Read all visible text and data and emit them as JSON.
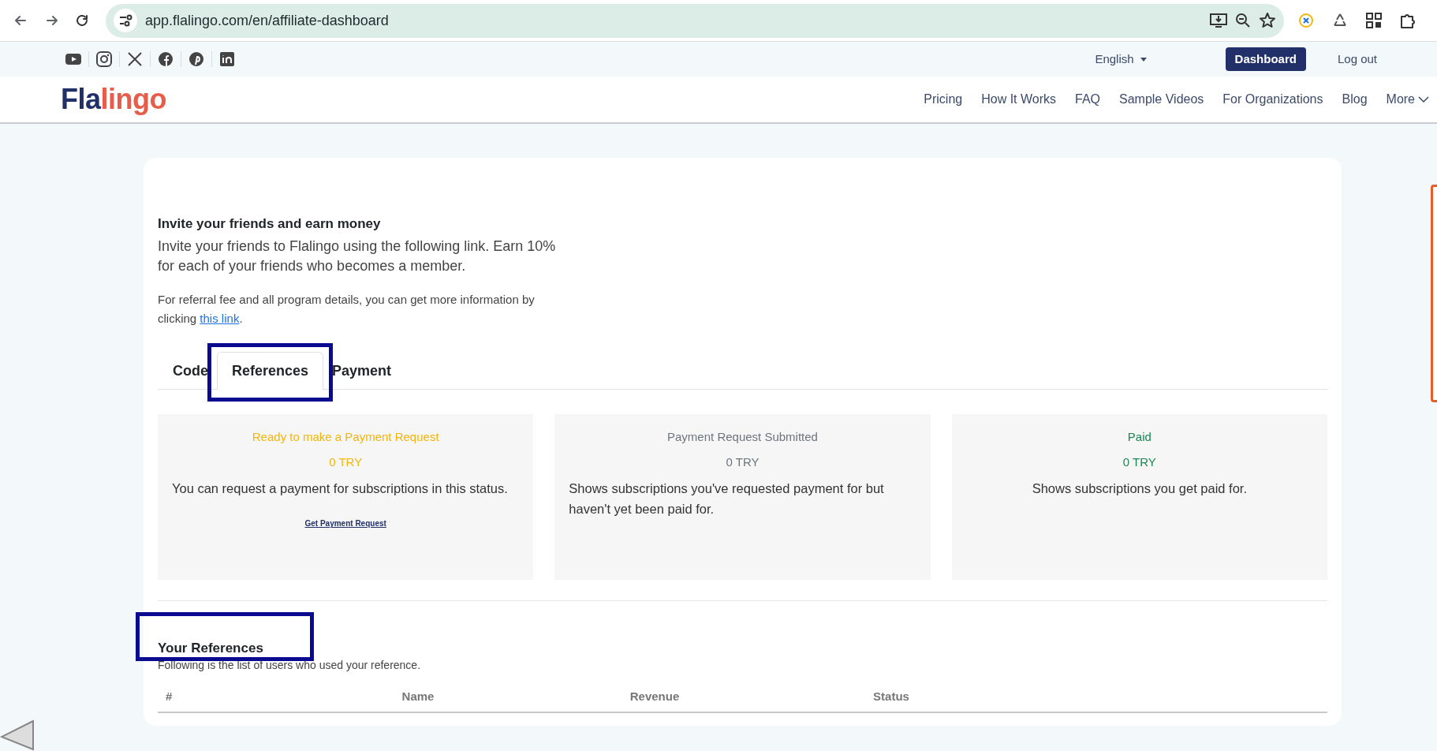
{
  "browser": {
    "url": "app.flalingo.com/en/affiliate-dashboard"
  },
  "topbar": {
    "language": "English",
    "dashboard_button": "Dashboard",
    "logout": "Log out"
  },
  "logo": {
    "part_1": "Fla",
    "part_2": "lingo"
  },
  "nav": [
    "Pricing",
    "How It Works",
    "FAQ",
    "Sample Videos",
    "For Organizations",
    "Blog"
  ],
  "nav_more": "More",
  "intro": {
    "title": "Invite your friends and earn money",
    "text": "Invite your friends to Flalingo using the following link. Earn 10% for each of your friends who becomes a member.",
    "details": "For referral fee and all program details, you can get more information by clicking",
    "details_link": "this link",
    "details_end": "."
  },
  "tabs": [
    {
      "label": "Code",
      "selected": false
    },
    {
      "label": "References",
      "selected": true
    },
    {
      "label": "Payment",
      "selected": false
    }
  ],
  "status_cards": [
    {
      "kind": "ready",
      "color": "#f5b50a",
      "title": "Ready to make a Payment Request",
      "amount": "0 TRY",
      "description": "You can request a payment for subscriptions in this status.",
      "link": "Get Payment Request"
    },
    {
      "kind": "submitted",
      "color": "#6c757d",
      "title": "Payment Request Submitted",
      "amount": "0 TRY",
      "description": "Shows subscriptions you've requested payment for but haven't yet been paid for."
    },
    {
      "kind": "paid",
      "color": "#198754",
      "title": "Paid",
      "amount": "0 TRY",
      "description": "Shows subscriptions you get paid for."
    }
  ],
  "references": {
    "title": "Your References",
    "subtitle": "Following is the list of users who used your reference.",
    "columns": [
      "#",
      "Name",
      "Revenue",
      "Status"
    ]
  }
}
